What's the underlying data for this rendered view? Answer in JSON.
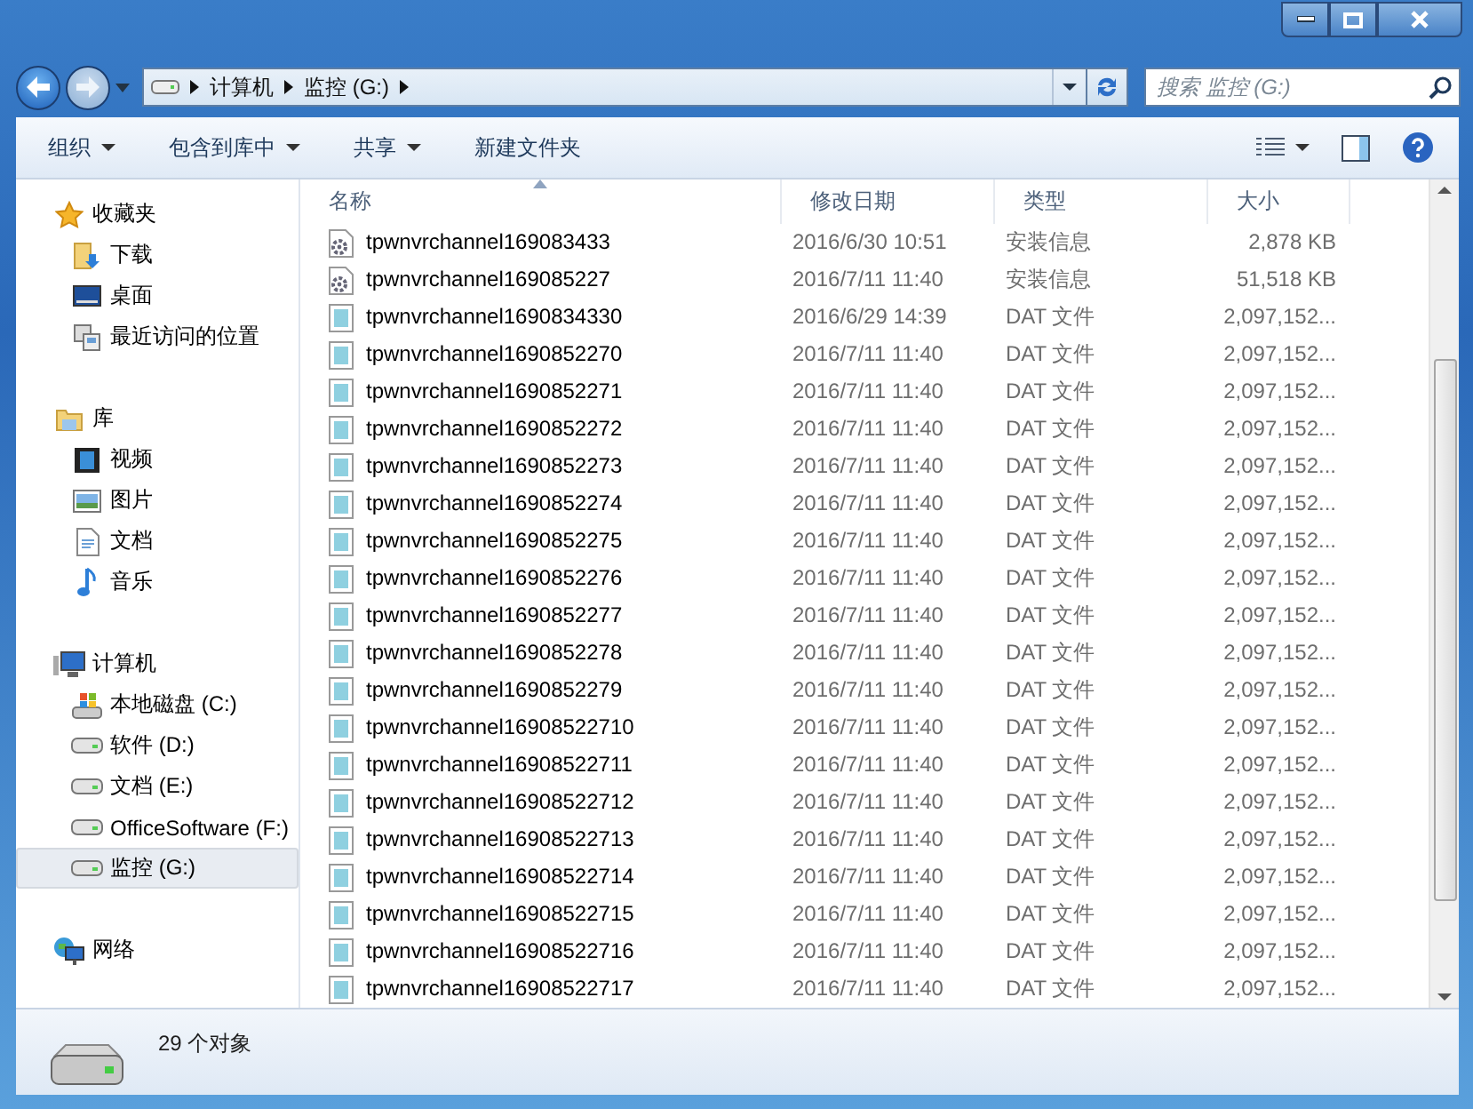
{
  "address": {
    "crumbs": [
      "计算机",
      "监控 (G:)"
    ]
  },
  "search": {
    "placeholder": "搜索 监控 (G:)"
  },
  "toolbar": {
    "buttons": [
      {
        "label": "组织",
        "dropdown": true
      },
      {
        "label": "包含到库中",
        "dropdown": true
      },
      {
        "label": "共享",
        "dropdown": true
      },
      {
        "label": "新建文件夹",
        "dropdown": false
      }
    ]
  },
  "sidebar": {
    "groups": [
      {
        "label": "收藏夹",
        "kind": "favorites",
        "selected": false,
        "children": [
          {
            "label": "下载",
            "kind": "downloads",
            "selected": false
          },
          {
            "label": "桌面",
            "kind": "desktop",
            "selected": false
          },
          {
            "label": "最近访问的位置",
            "kind": "recent",
            "selected": false
          }
        ]
      },
      {
        "label": "库",
        "kind": "library",
        "selected": false,
        "children": [
          {
            "label": "视频",
            "kind": "video",
            "selected": false
          },
          {
            "label": "图片",
            "kind": "pictures",
            "selected": false
          },
          {
            "label": "文档",
            "kind": "documents",
            "selected": false
          },
          {
            "label": "音乐",
            "kind": "music",
            "selected": false
          }
        ]
      },
      {
        "label": "计算机",
        "kind": "computer",
        "selected": false,
        "children": [
          {
            "label": "本地磁盘 (C:)",
            "kind": "system-drive",
            "selected": false
          },
          {
            "label": "软件 (D:)",
            "kind": "drive",
            "selected": false
          },
          {
            "label": "文档 (E:)",
            "kind": "drive",
            "selected": false
          },
          {
            "label": "OfficeSoftware (F:)",
            "kind": "drive",
            "selected": false
          },
          {
            "label": "监控 (G:)",
            "kind": "drive",
            "selected": true
          }
        ]
      },
      {
        "label": "网络",
        "kind": "network",
        "selected": false
      }
    ]
  },
  "table": {
    "columns": [
      {
        "label": "名称",
        "sorted": true
      },
      {
        "label": "修改日期",
        "sorted": false
      },
      {
        "label": "类型",
        "sorted": false
      },
      {
        "label": "大小",
        "sorted": false
      }
    ],
    "rows": [
      {
        "name": "tpwnvrchannel169083433",
        "date": "2016/6/30 10:51",
        "type": "安装信息",
        "size": "2,878 KB",
        "kind": "setup"
      },
      {
        "name": "tpwnvrchannel169085227",
        "date": "2016/7/11 11:40",
        "type": "安装信息",
        "size": "51,518 KB",
        "kind": "setup"
      },
      {
        "name": "tpwnvrchannel1690834330",
        "date": "2016/6/29 14:39",
        "type": "DAT 文件",
        "size": "2,097,152...",
        "kind": "dat"
      },
      {
        "name": "tpwnvrchannel1690852270",
        "date": "2016/7/11 11:40",
        "type": "DAT 文件",
        "size": "2,097,152...",
        "kind": "dat"
      },
      {
        "name": "tpwnvrchannel1690852271",
        "date": "2016/7/11 11:40",
        "type": "DAT 文件",
        "size": "2,097,152...",
        "kind": "dat"
      },
      {
        "name": "tpwnvrchannel1690852272",
        "date": "2016/7/11 11:40",
        "type": "DAT 文件",
        "size": "2,097,152...",
        "kind": "dat"
      },
      {
        "name": "tpwnvrchannel1690852273",
        "date": "2016/7/11 11:40",
        "type": "DAT 文件",
        "size": "2,097,152...",
        "kind": "dat"
      },
      {
        "name": "tpwnvrchannel1690852274",
        "date": "2016/7/11 11:40",
        "type": "DAT 文件",
        "size": "2,097,152...",
        "kind": "dat"
      },
      {
        "name": "tpwnvrchannel1690852275",
        "date": "2016/7/11 11:40",
        "type": "DAT 文件",
        "size": "2,097,152...",
        "kind": "dat"
      },
      {
        "name": "tpwnvrchannel1690852276",
        "date": "2016/7/11 11:40",
        "type": "DAT 文件",
        "size": "2,097,152...",
        "kind": "dat"
      },
      {
        "name": "tpwnvrchannel1690852277",
        "date": "2016/7/11 11:40",
        "type": "DAT 文件",
        "size": "2,097,152...",
        "kind": "dat"
      },
      {
        "name": "tpwnvrchannel1690852278",
        "date": "2016/7/11 11:40",
        "type": "DAT 文件",
        "size": "2,097,152...",
        "kind": "dat"
      },
      {
        "name": "tpwnvrchannel1690852279",
        "date": "2016/7/11 11:40",
        "type": "DAT 文件",
        "size": "2,097,152...",
        "kind": "dat"
      },
      {
        "name": "tpwnvrchannel16908522710",
        "date": "2016/7/11 11:40",
        "type": "DAT 文件",
        "size": "2,097,152...",
        "kind": "dat"
      },
      {
        "name": "tpwnvrchannel16908522711",
        "date": "2016/7/11 11:40",
        "type": "DAT 文件",
        "size": "2,097,152...",
        "kind": "dat"
      },
      {
        "name": "tpwnvrchannel16908522712",
        "date": "2016/7/11 11:40",
        "type": "DAT 文件",
        "size": "2,097,152...",
        "kind": "dat"
      },
      {
        "name": "tpwnvrchannel16908522713",
        "date": "2016/7/11 11:40",
        "type": "DAT 文件",
        "size": "2,097,152...",
        "kind": "dat"
      },
      {
        "name": "tpwnvrchannel16908522714",
        "date": "2016/7/11 11:40",
        "type": "DAT 文件",
        "size": "2,097,152...",
        "kind": "dat"
      },
      {
        "name": "tpwnvrchannel16908522715",
        "date": "2016/7/11 11:40",
        "type": "DAT 文件",
        "size": "2,097,152...",
        "kind": "dat"
      },
      {
        "name": "tpwnvrchannel16908522716",
        "date": "2016/7/11 11:40",
        "type": "DAT 文件",
        "size": "2,097,152...",
        "kind": "dat"
      },
      {
        "name": "tpwnvrchannel16908522717",
        "date": "2016/7/11 11:40",
        "type": "DAT 文件",
        "size": "2,097,152...",
        "kind": "dat"
      }
    ]
  },
  "status_bar": {
    "count": "29 个对象"
  }
}
